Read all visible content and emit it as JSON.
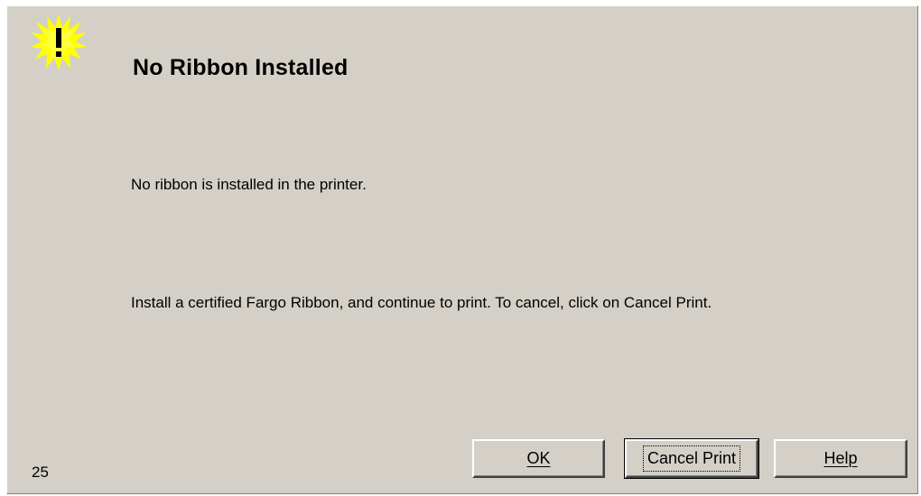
{
  "dialog": {
    "icon": "warning-exclamation-icon",
    "title": "No Ribbon Installed",
    "message_line1": "No ribbon is installed in the printer.",
    "message_line2": "Install a certified Fargo Ribbon, and continue to print. To cancel, click on Cancel Print.",
    "error_code": "25",
    "buttons": {
      "ok_label": "OK",
      "cancel_label": "Cancel Print",
      "help_label": "Help"
    },
    "colors": {
      "background": "#d4d0c8",
      "icon_fill": "#ffff00",
      "text": "#000000"
    }
  }
}
